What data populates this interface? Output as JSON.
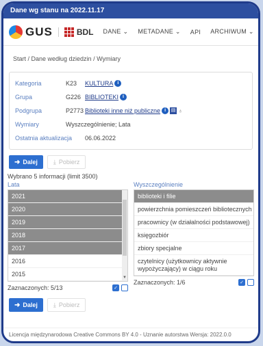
{
  "topbar": "Dane wg stanu na 2022.11.17",
  "logo": {
    "gus": "GUS",
    "bdl": "BDL"
  },
  "nav": [
    "DANE ⌄",
    "METADANE ⌄",
    "API",
    "ARCHIWUM ⌄"
  ],
  "breadcrumb": "Start  /  Dane według dziedzin  /  Wymiary",
  "info": {
    "kategoria": {
      "label": "Kategoria",
      "code": "K23",
      "value": "KULTURA"
    },
    "grupa": {
      "label": "Grupa",
      "code": "G226",
      "value": "BIBLIOTEKI"
    },
    "podgrupa": {
      "label": "Podgrupa",
      "code": "P2773",
      "value": "Biblioteki inne niż publiczne"
    },
    "wymiary": {
      "label": "Wymiary",
      "value": "Wyszczególnienie; Lata"
    },
    "aktualizacja": {
      "label": "Ostatnia aktualizacja",
      "value": "06.06.2022"
    }
  },
  "buttons": {
    "dalej": "Dalej",
    "pobierz": "Pobierz"
  },
  "selected_info": "Wybrano 5 informacji (limit 3500)",
  "lata": {
    "title": "Lata",
    "items": [
      "2021",
      "2020",
      "2019",
      "2018",
      "2017",
      "2016",
      "2015"
    ],
    "selected": [
      true,
      true,
      true,
      true,
      true,
      false,
      false
    ],
    "status": "Zaznaczonych: 5/13"
  },
  "wyszczegolnienie": {
    "title": "Wyszczególnienie",
    "items": [
      "biblioteki i filie",
      "powierzchnia pomieszczeń bibliotecznych",
      "pracownicy (w działalności podstawowej)",
      "księgozbiór",
      "zbiory specjalne",
      "czytelnicy (użytkownicy aktywnie wypożyczający) w ciągu roku"
    ],
    "selected": [
      true,
      false,
      false,
      false,
      false,
      false
    ],
    "status": "Zaznaczonych: 1/6"
  },
  "footer": "Licencja międzynarodowa Creative Commons BY 4.0 - Uznanie autorstwa Wersja: 2022.0.0",
  "colors": {
    "accent": "#2d6fd0",
    "brand": "#1f3b8a"
  }
}
